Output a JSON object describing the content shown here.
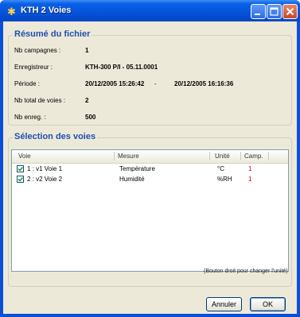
{
  "window": {
    "title": "KTH 2 Voies",
    "icon": "app-star-icon"
  },
  "file_summary": {
    "title": "Résumé du fichier",
    "rows": [
      {
        "label": "Nb campagnes :",
        "value": "1",
        "value2": "",
        "separator": ""
      },
      {
        "label": "Enregistreur :",
        "value": "KTH-300 P/I - 05.11.0001",
        "value2": "",
        "separator": ""
      },
      {
        "label": "Période :",
        "value": "20/12/2005 15:26:42",
        "separator": "-",
        "value2": "20/12/2005 16:16:36"
      },
      {
        "label": "Nb total de voies :",
        "value": "2",
        "value2": "",
        "separator": ""
      },
      {
        "label": "Nb enreg. :",
        "value": "500",
        "value2": "",
        "separator": ""
      }
    ]
  },
  "channel_selection": {
    "title": "Sélection des voies",
    "columns": [
      "Voie",
      "Mesure",
      "Unité",
      "Camp."
    ],
    "rows": [
      {
        "checked": true,
        "voie": "1 :  v1 Voie 1",
        "mesure": "Température",
        "unite": "°C",
        "camp": "1"
      },
      {
        "checked": true,
        "voie": "2 :  v2 Voie 2",
        "mesure": "Humidité",
        "unite": "%RH",
        "camp": "1"
      }
    ],
    "hint": "(Bouton droit pour changer l'unité)"
  },
  "buttons": {
    "cancel": "Annuler",
    "ok": "OK"
  },
  "colors": {
    "titlebar": "#0553d8",
    "group_title": "#1f4fb0",
    "dialog_bg": "#ece9d8",
    "camp_value": "#c00000"
  }
}
